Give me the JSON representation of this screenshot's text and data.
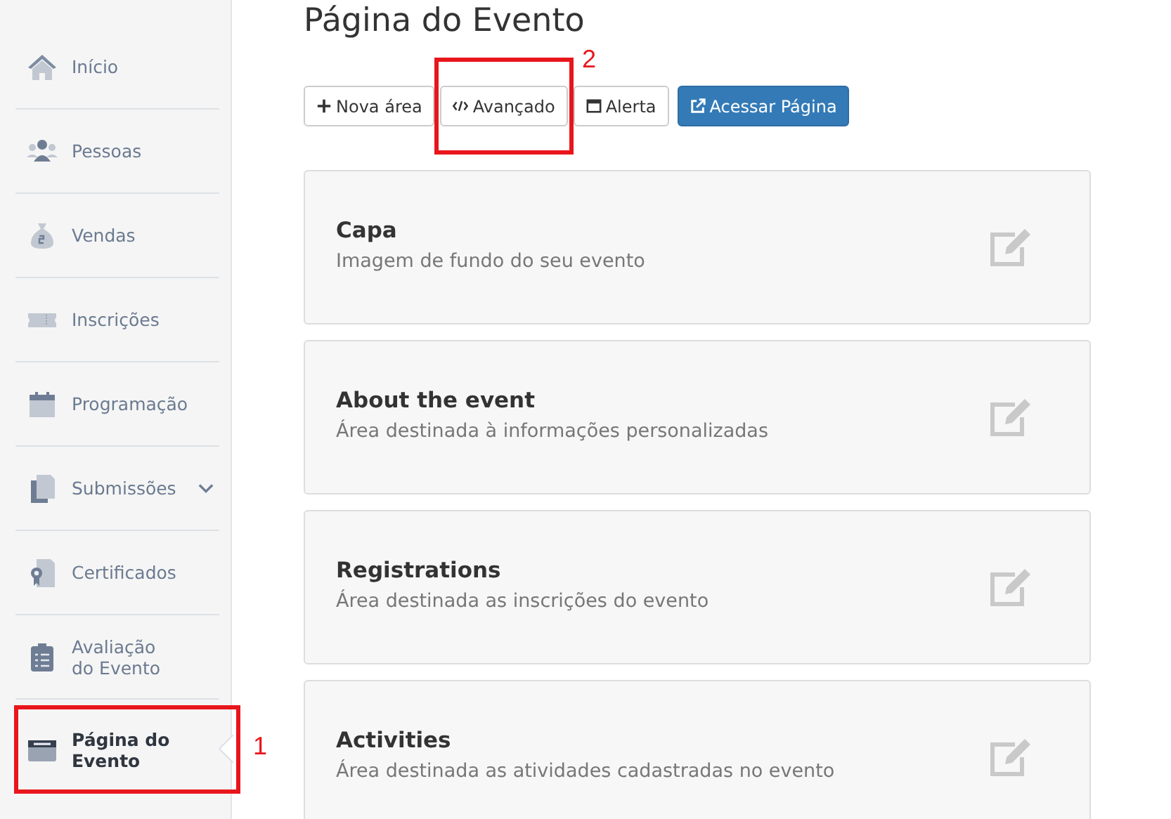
{
  "sidebar": {
    "items": [
      {
        "label": "Início",
        "selected": false,
        "expandable": false
      },
      {
        "label": "Pessoas",
        "selected": false,
        "expandable": false
      },
      {
        "label": "Vendas",
        "selected": false,
        "expandable": false
      },
      {
        "label": "Inscrições",
        "selected": false,
        "expandable": false
      },
      {
        "label": "Programação",
        "selected": false,
        "expandable": false
      },
      {
        "label": "Submissões",
        "selected": false,
        "expandable": true
      },
      {
        "label": "Certificados",
        "selected": false,
        "expandable": false
      },
      {
        "label": "Avaliação do Evento",
        "selected": false,
        "expandable": false
      },
      {
        "label": "Página do Evento",
        "selected": true,
        "expandable": false
      }
    ]
  },
  "page_title": "Página do Evento",
  "toolbar": [
    {
      "label": "Nova área",
      "kind": "plus"
    },
    {
      "label": "Avançado",
      "kind": "code"
    },
    {
      "label": "Alerta",
      "kind": "window"
    },
    {
      "label": "Acessar Página",
      "kind": "primary"
    }
  ],
  "sections": [
    {
      "title": "Capa",
      "description": "Imagem de fundo do seu evento"
    },
    {
      "title": "About the event",
      "description": "Área destinada à informações personalizadas"
    },
    {
      "title": "Registrations",
      "description": "Área destinada as inscrições do evento"
    },
    {
      "title": "Activities",
      "description": "Área destinada as atividades cadastradas no evento"
    }
  ],
  "annotations": [
    {
      "label": "1"
    },
    {
      "label": "2"
    }
  ]
}
